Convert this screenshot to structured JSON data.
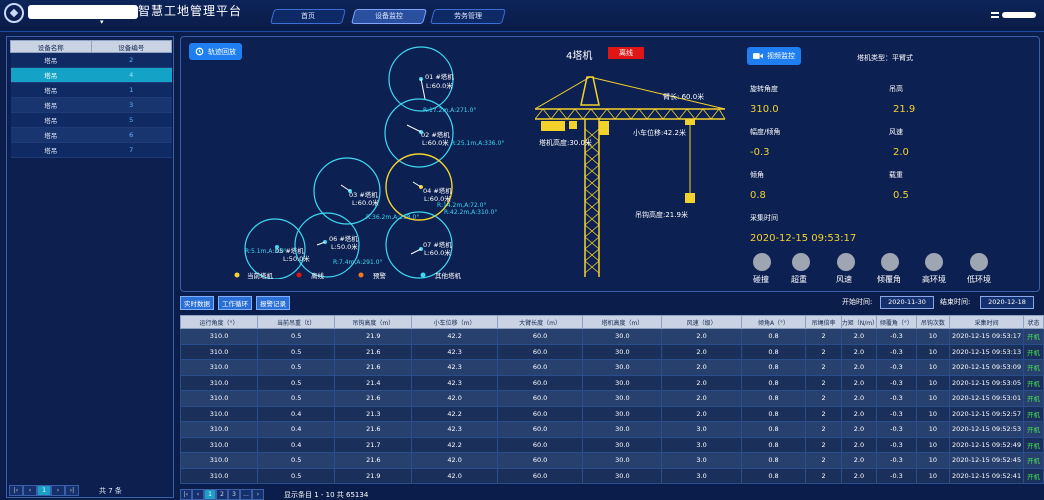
{
  "header": {
    "app_title": "智慧工地管理平台",
    "nav": [
      "首页",
      "设备监控",
      "劳务管理"
    ],
    "active_nav": 1
  },
  "device_list": {
    "columns": [
      "设备名称",
      "设备编号"
    ],
    "rows": [
      {
        "name": "塔吊",
        "code": "2"
      },
      {
        "name": "塔吊",
        "code": "4"
      },
      {
        "name": "塔吊",
        "code": "1"
      },
      {
        "name": "塔吊",
        "code": "3"
      },
      {
        "name": "塔吊",
        "code": "5"
      },
      {
        "name": "塔吊",
        "code": "6"
      },
      {
        "name": "塔吊",
        "code": "7"
      }
    ],
    "selected_index": 1,
    "pager": {
      "pages": [
        "",
        "",
        "1",
        "",
        ""
      ],
      "total": "共 7 条"
    }
  },
  "monitor": {
    "replay_button": "轨迹回放",
    "video_button": "视频监控",
    "crane_title": "4塔机",
    "status_badge": "离线",
    "crane_type": "塔机类型：平臂式",
    "crane_labels": {
      "arm_length": "臂长: 60.0米",
      "trolley_pos": "小车位移:42.2米",
      "tower_height": "塔机高度:30.0米",
      "hook_height": "吊钩高度:21.9米"
    },
    "params": [
      {
        "label": "旋转角度",
        "value": "310.0"
      },
      {
        "label": "吊高",
        "value": "21.9"
      },
      {
        "label": "幅度/倾角",
        "value": "-0.3"
      },
      {
        "label": "风速",
        "value": "2.0"
      },
      {
        "label": "倾角",
        "value": "0.8"
      },
      {
        "label": "载重",
        "value": "0.5"
      }
    ],
    "time_label": "采集时间",
    "time_value": "2020-12-15 09:53:17",
    "alarms": [
      "碰撞",
      "超重",
      "风速",
      "倾覆角",
      "高环境",
      "低环境"
    ]
  },
  "map": {
    "cranes": [
      {
        "id": "01",
        "name": "01 #塔机",
        "len": "L:60.0米",
        "info": "R:17.2m,A:271.0°"
      },
      {
        "id": "02",
        "name": "02 #塔机",
        "len": "L:60.0米",
        "info": "R:25.1m,A:336.0°"
      },
      {
        "id": "03",
        "name": "03 #塔机",
        "len": "L:60.0米",
        "info": "R:36.2m,A:298.0°"
      },
      {
        "id": "04",
        "name": "04 #塔机",
        "len": "L:60.0米",
        "info": "R:14.2m,A:72.0°",
        "info2": "R:42.2m,A:310.0°"
      },
      {
        "id": "05",
        "name": "05 #塔机",
        "len": "L:50.0米",
        "info": "R:5.1m,A:3.0°"
      },
      {
        "id": "06",
        "name": "06 #塔机",
        "len": "L:50.0米",
        "info": "R:7.4m,A:291.0°"
      },
      {
        "id": "07",
        "name": "07 #塔机",
        "len": "L:60.0米",
        "info": ""
      }
    ],
    "legend": [
      "当前塔机",
      "离线",
      "预警",
      "其他塔机"
    ],
    "colors": {
      "current": "#f3d22e",
      "offline": "#e01515",
      "warning": "#f07a1a",
      "other": "#3fd8f0"
    }
  },
  "records": {
    "tabs": [
      "实时数据",
      "工作循环",
      "报警记录"
    ],
    "start_label": "开始时间:",
    "start_value": "2020-11-30",
    "end_label": "结束时间:",
    "end_value": "2020-12-18",
    "columns": [
      "运行角度（°）",
      "当前吊重（t）",
      "吊钩高度（m）",
      "小车位移（m）",
      "大臂长度（m）",
      "塔机高度（m）",
      "风速（级）",
      "倾角A（°）",
      "吊绳倍率",
      "力矩（N/m）",
      "倾覆角（°）",
      "吊钩次数",
      "采集时间",
      "状态"
    ],
    "rows": [
      [
        "310.0",
        "0.5",
        "21.9",
        "42.2",
        "60.0",
        "30.0",
        "2.0",
        "0.8",
        "2",
        "2.0",
        "-0.3",
        "10",
        "2020-12-15 09:53:17",
        "开机"
      ],
      [
        "310.0",
        "0.5",
        "21.6",
        "42.3",
        "60.0",
        "30.0",
        "2.0",
        "0.8",
        "2",
        "2.0",
        "-0.3",
        "10",
        "2020-12-15 09:53:13",
        "开机"
      ],
      [
        "310.0",
        "0.5",
        "21.6",
        "42.3",
        "60.0",
        "30.0",
        "2.0",
        "0.8",
        "2",
        "2.0",
        "-0.3",
        "10",
        "2020-12-15 09:53:09",
        "开机"
      ],
      [
        "310.0",
        "0.5",
        "21.4",
        "42.3",
        "60.0",
        "30.0",
        "2.0",
        "0.8",
        "2",
        "2.0",
        "-0.3",
        "10",
        "2020-12-15 09:53:05",
        "开机"
      ],
      [
        "310.0",
        "0.5",
        "21.6",
        "42.0",
        "60.0",
        "30.0",
        "2.0",
        "0.8",
        "2",
        "2.0",
        "-0.3",
        "10",
        "2020-12-15 09:53:01",
        "开机"
      ],
      [
        "310.0",
        "0.4",
        "21.3",
        "42.2",
        "60.0",
        "30.0",
        "2.0",
        "0.8",
        "2",
        "2.0",
        "-0.3",
        "10",
        "2020-12-15 09:52:57",
        "开机"
      ],
      [
        "310.0",
        "0.4",
        "21.6",
        "42.3",
        "60.0",
        "30.0",
        "3.0",
        "0.8",
        "2",
        "2.0",
        "-0.3",
        "10",
        "2020-12-15 09:52:53",
        "开机"
      ],
      [
        "310.0",
        "0.4",
        "21.7",
        "42.2",
        "60.0",
        "30.0",
        "3.0",
        "0.8",
        "2",
        "2.0",
        "-0.3",
        "10",
        "2020-12-15 09:52:49",
        "开机"
      ],
      [
        "310.0",
        "0.5",
        "21.6",
        "42.0",
        "60.0",
        "30.0",
        "3.0",
        "0.8",
        "2",
        "2.0",
        "-0.3",
        "10",
        "2020-12-15 09:52:45",
        "开机"
      ],
      [
        "310.0",
        "0.5",
        "21.9",
        "42.0",
        "60.0",
        "30.0",
        "3.0",
        "0.8",
        "2",
        "2.0",
        "-0.3",
        "10",
        "2020-12-15 09:52:41",
        "开机"
      ]
    ],
    "pager": {
      "pages": [
        "",
        "1",
        "2",
        "3",
        "...",
        ""
      ],
      "info": "显示条目 1 - 10 共 65134"
    }
  }
}
